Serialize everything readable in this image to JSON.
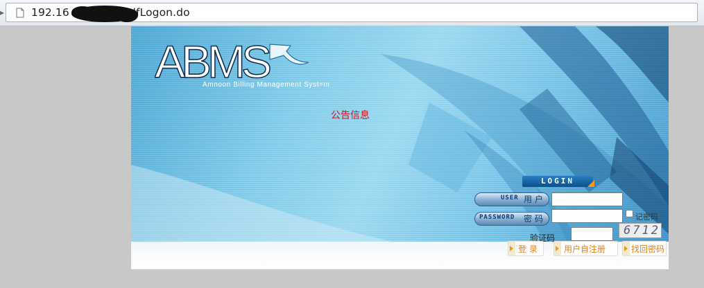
{
  "browser": {
    "url": "192.168.█████selfLogon.do",
    "url_visible_prefix": "192.16",
    "url_visible_suffix": "selfLogon.do"
  },
  "header": {
    "logo": "ABMS",
    "subtitle": "Amnoon Billing Management Syst=m"
  },
  "notice": {
    "text": "公告信息"
  },
  "login": {
    "badge": "LOGIN",
    "user_label_en": "USER",
    "user_label_cn": "用户",
    "user_value": "",
    "password_label_en": "PASSWORD",
    "password_label_cn": "密码",
    "password_value": "",
    "remember_label": "记密码",
    "captcha_label": "验证码",
    "captcha_value": "",
    "captcha_image_text": "6712"
  },
  "actions": {
    "login": "登  录",
    "register": "用户自注册",
    "recover": "找回密码"
  },
  "colors": {
    "notice": "#d0161d",
    "action_text": "#e0801a",
    "panel_blue": "#4aa6d3"
  }
}
